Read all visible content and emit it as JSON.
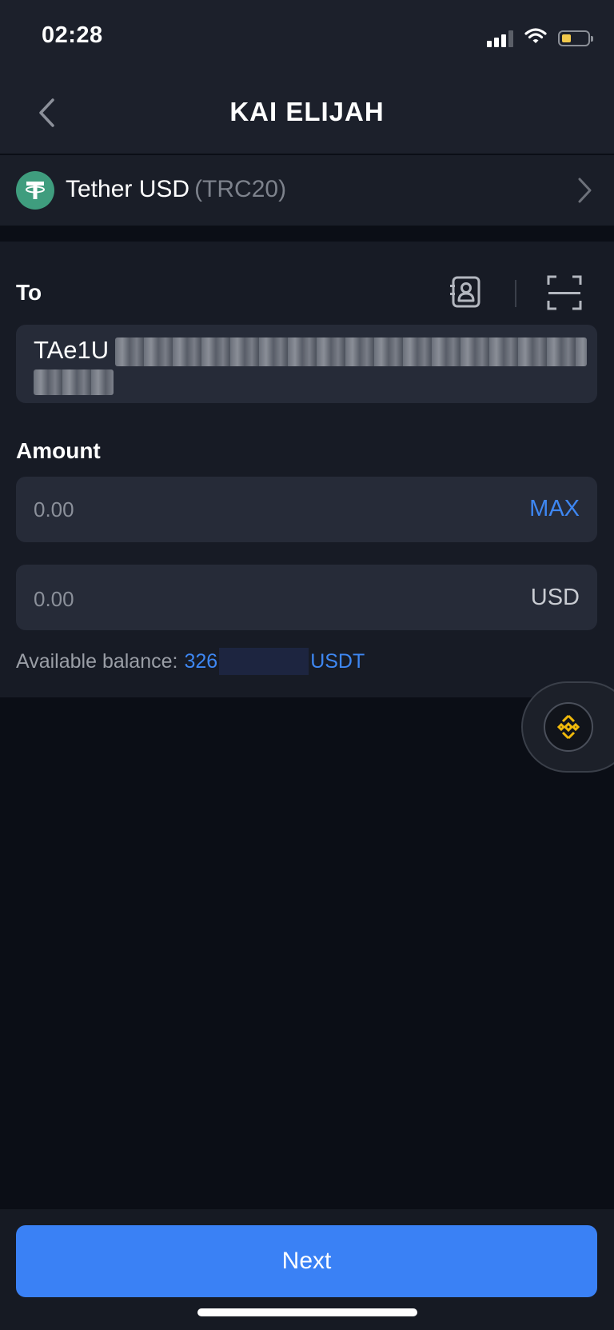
{
  "status_bar": {
    "time": "02:28",
    "icons": [
      "cellular-signal-icon",
      "wifi-icon",
      "battery-low-icon"
    ]
  },
  "header": {
    "title": "KAI ELIJAH",
    "back_icon": "chevron-left-icon"
  },
  "token": {
    "name": "Tether USD",
    "network": "(TRC20)",
    "logo_icon": "tether-logo-icon",
    "chevron_icon": "chevron-right-icon"
  },
  "to_section": {
    "label": "To",
    "address_visible": "TAe1U",
    "address_blurred": true,
    "icons": [
      "address-book-icon",
      "scan-icon"
    ]
  },
  "amount_section": {
    "label": "Amount",
    "token_amount": {
      "value": "0.00",
      "suffix": "MAX"
    },
    "fiat_amount": {
      "value": "0.00",
      "suffix": "USD"
    }
  },
  "balance": {
    "label": "Available balance:",
    "value_prefix": "326",
    "unit": "USDT",
    "value_masked": true
  },
  "floating_widget": {
    "icon": "binance-logo-icon"
  },
  "footer": {
    "next_label": "Next"
  },
  "colors": {
    "accent": "#3a81f5",
    "link": "#3e87f2",
    "background": "#0b0e16",
    "panel": "#171b25",
    "tether": "#3f9d7e",
    "binance": "#f0b90b"
  }
}
